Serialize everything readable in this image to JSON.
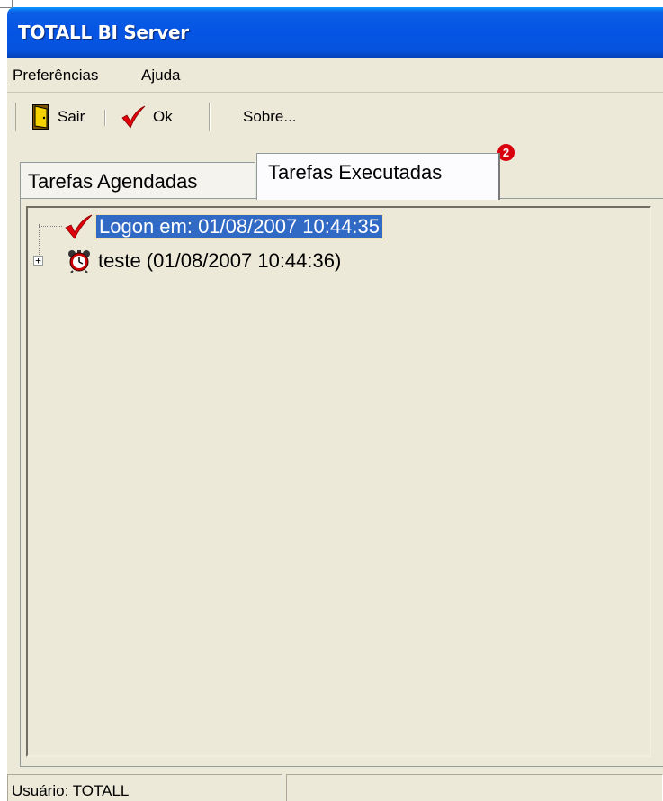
{
  "window": {
    "title": "TOTALL BI Server"
  },
  "menu": {
    "items": [
      {
        "label": "Preferências"
      },
      {
        "label": "Ajuda"
      }
    ]
  },
  "toolbar": {
    "exit_label": "Sair",
    "ok_label": "Ok",
    "about_label": "Sobre..."
  },
  "tabs": {
    "items": [
      {
        "label": "Tarefas Agendadas",
        "active": false
      },
      {
        "label": "Tarefas Executadas",
        "active": true
      }
    ],
    "badge": "2"
  },
  "tree": {
    "nodes": [
      {
        "label": "Logon em: 01/08/2007 10:44:35",
        "icon": "checkmark-icon",
        "selected": true
      },
      {
        "label": "teste (01/08/2007 10:44:36)",
        "icon": "alarm-clock-icon",
        "expander": "+"
      }
    ]
  },
  "status": {
    "user_label": "Usuário: TOTALL",
    "secondary": ""
  },
  "colors": {
    "titlebar": "#0554e3",
    "selection": "#316ac5",
    "window_bg": "#ece9d8",
    "badge": "#d8000c",
    "check": "#e0000c"
  }
}
